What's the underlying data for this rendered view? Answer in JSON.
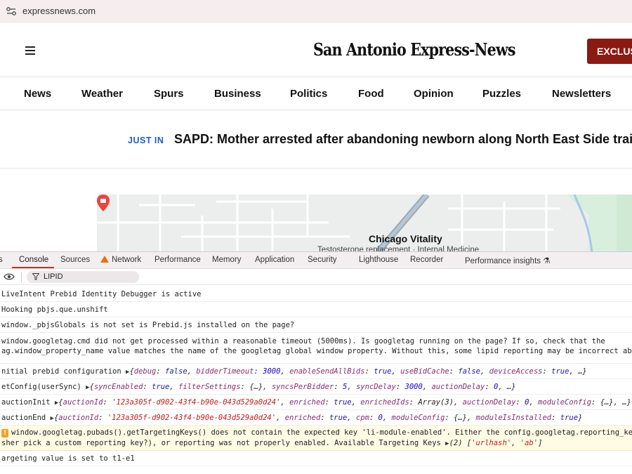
{
  "browser": {
    "url": "expressnews.com",
    "site_settings_icon": "site-settings-icon"
  },
  "header": {
    "menu_icon": "hamburger-menu-icon",
    "logo_text": "San Antonio Express-News",
    "exclusive_button": "EXCLUS"
  },
  "nav": {
    "items": [
      "News",
      "Weather",
      "Spurs",
      "Business",
      "Politics",
      "Food",
      "Opinion",
      "Puzzles",
      "Newsletters"
    ]
  },
  "just_in": {
    "label": "JUST IN",
    "headline": "SAPD: Mother arrested after abandoning newborn along North East Side trail"
  },
  "map_ad": {
    "place_name": "Chicago Vitality",
    "subtitle": "Testosterone replacement · Internal Medicine"
  },
  "devtools": {
    "tabs": [
      "s",
      "Console",
      "Sources",
      "Network",
      "Performance",
      "Memory",
      "Application",
      "Security",
      "Lighthouse",
      "Recorder",
      "Performance insights"
    ],
    "active_tab": "Console",
    "filter_value": "LIPID",
    "logs": {
      "l1": "LiveIntent Prebid Identity Debugger is active",
      "l2": "Hooking pbjs.que.unshift",
      "l3": "window._pbjsGlobals is not set is Prebid.js installed on the page?",
      "l4a": "window.googletag.cmd did not get processed within a reasonable timeout (5000ms). Is googletag running on the page? If so, check that the",
      "l4b": "ag.window_property_name value matches the name of the googletag global window property. Without this, some lipid reporting may be incorrect about CONTR",
      "l5_prefix": "nitial prebid configuration",
      "l6_prefix": "etConfig(userSync)",
      "l7_prefix": "auctionInit",
      "l8_prefix": "auctionEnd",
      "l9a": "window.googletag.pubads().getTargetingKeys() does not contain the expected key 'li-module-enabled'. Either the config.googletag.reporting_key in LIP",
      "l9b_prefix": "sher pick a custom reporting key?), or reporting was not properly enabled. Available Targeting Keys",
      "l10": "argeting value is set to t1-e1"
    },
    "colors": {
      "accent": "#b03a2e",
      "warn_bg": "#fffbe5",
      "key": "#8a2b73",
      "string": "#c41a16",
      "number": "#1c00cf"
    }
  }
}
